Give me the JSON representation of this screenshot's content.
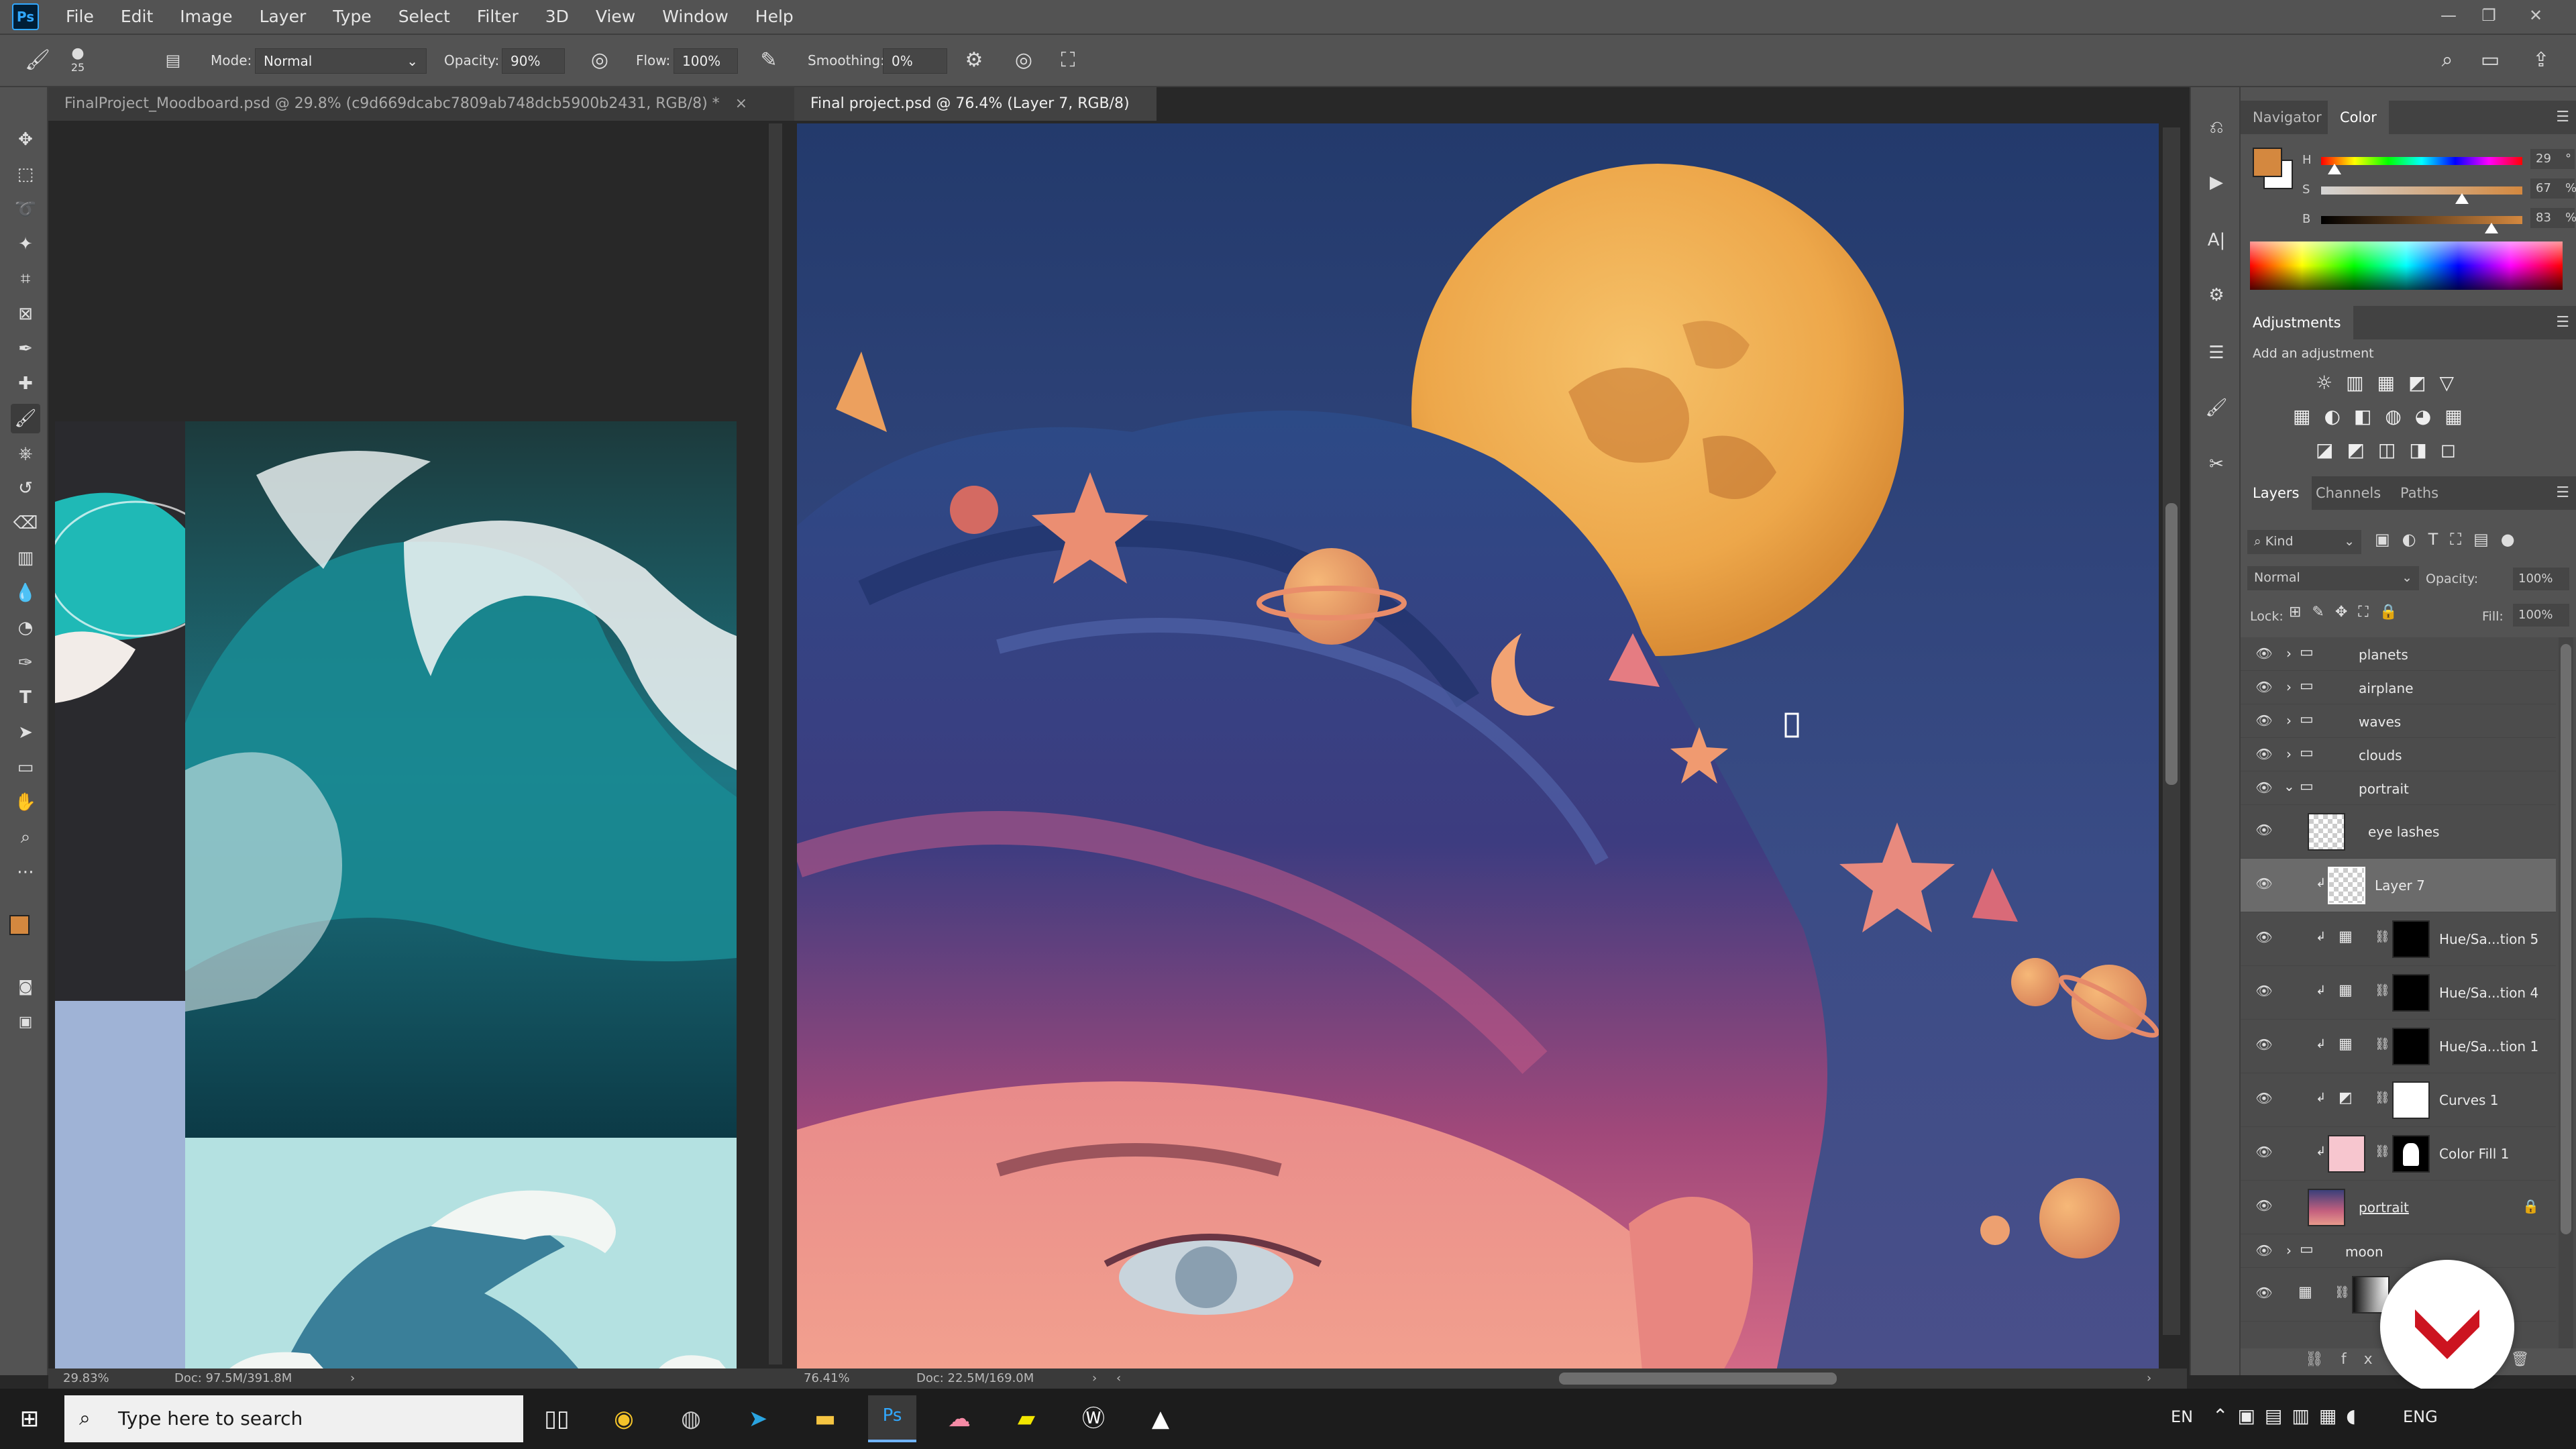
{
  "app": {
    "logo": "Ps"
  },
  "menu": [
    "File",
    "Edit",
    "Image",
    "Layer",
    "Type",
    "Select",
    "Filter",
    "3D",
    "View",
    "Window",
    "Help"
  ],
  "window_controls": {
    "minimize": "—",
    "restore": "❐",
    "close": "✕"
  },
  "options": {
    "brush_size": "25",
    "mode_label": "Mode:",
    "mode_value": "Normal",
    "opacity_label": "Opacity:",
    "opacity_value": "90%",
    "flow_label": "Flow:",
    "flow_value": "100%",
    "smoothing_label": "Smoothing:",
    "smoothing_value": "0%"
  },
  "documents": {
    "tab_a": "FinalProject_Moodboard.psd @ 29.8% (c9d669dcabc7809ab748dcb5900b2431, RGB/8) *",
    "tab_a_close": "×",
    "tab_b": "Final project.psd @ 76.4% (Layer 7, RGB/8) *",
    "tab_b_close": "×",
    "status_a_zoom": "29.83%",
    "status_a_doc": "Doc: 97.5M/391.8M",
    "status_b_zoom": "76.41%",
    "status_b_doc": "Doc: 22.5M/169.0M"
  },
  "color_panel": {
    "tabs": [
      "Navigator",
      "Color"
    ],
    "h_label": "H",
    "h_value": "29",
    "h_unit": "°",
    "s_label": "S",
    "s_value": "67",
    "s_unit": "%",
    "b_label": "B",
    "b_value": "83",
    "b_unit": "%",
    "foreground": "#d4883f",
    "background": "#ffffff"
  },
  "adjustments": {
    "title": "Adjustments",
    "hint": "Add an adjustment"
  },
  "layers_panel": {
    "tabs": [
      "Layers",
      "Channels",
      "Paths"
    ],
    "filter_kind": "Kind",
    "blend_mode": "Normal",
    "opacity_label": "Opacity:",
    "opacity_value": "100%",
    "lock_label": "Lock:",
    "fill_label": "Fill:",
    "fill_value": "100%",
    "layers": [
      {
        "name": "planets",
        "type": "group"
      },
      {
        "name": "airplane",
        "type": "group"
      },
      {
        "name": "waves",
        "type": "group"
      },
      {
        "name": "clouds",
        "type": "group"
      },
      {
        "name": "portrait",
        "type": "group-open"
      },
      {
        "name": "eye lashes",
        "type": "pixel"
      },
      {
        "name": "Layer 7",
        "type": "pixel",
        "selected": true
      },
      {
        "name": "Hue/Sa...tion 5",
        "type": "adjust"
      },
      {
        "name": "Hue/Sa...tion 4",
        "type": "adjust"
      },
      {
        "name": "Hue/Sa...tion 1",
        "type": "adjust"
      },
      {
        "name": "Curves 1",
        "type": "adjust"
      },
      {
        "name": "Color Fill 1",
        "type": "fill"
      },
      {
        "name": "portrait",
        "type": "smart"
      },
      {
        "name": "moon",
        "type": "group"
      }
    ]
  },
  "taskbar": {
    "search_placeholder": "Type here to search",
    "lang1": "EN",
    "lang2": "ENG"
  }
}
